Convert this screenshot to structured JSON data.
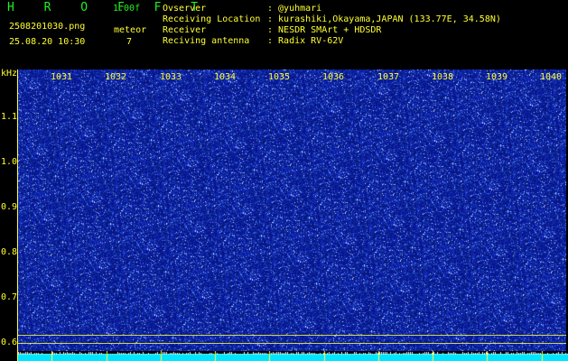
{
  "header": {
    "title": "H R O F F T",
    "version": "1.00f",
    "filename": "2508201030.png",
    "datetime": "25.08.20 10:30",
    "meteor_label": "meteor",
    "meteor_count": "7",
    "info": [
      {
        "label": "Ovserver",
        "value": ": @yuhmari"
      },
      {
        "label": "Receiving Location",
        "value": ": kurashiki,Okayama,JAPAN (133.77E, 34.58N)"
      },
      {
        "label": "Receiver",
        "value": ": NESDR SMArt + HDSDR"
      },
      {
        "label": "Reciving antenna",
        "value": ": Radix RV-62V"
      }
    ]
  },
  "freq_axis": {
    "ticks": [
      "1031",
      "1032",
      "1033",
      "1034",
      "1035",
      "1036",
      "1037",
      "1038",
      "1039",
      "1040"
    ]
  },
  "y_axis": {
    "unit": "kHz",
    "ticks": [
      "1.1",
      "1.0",
      "0.9",
      "0.8",
      "0.7",
      "0.6"
    ]
  },
  "colors": {
    "background": "#000000",
    "label": "#ffff33",
    "title": "#22ee22",
    "waterfall_base": "#0a1aa0",
    "strip": "#00e5ff"
  }
}
